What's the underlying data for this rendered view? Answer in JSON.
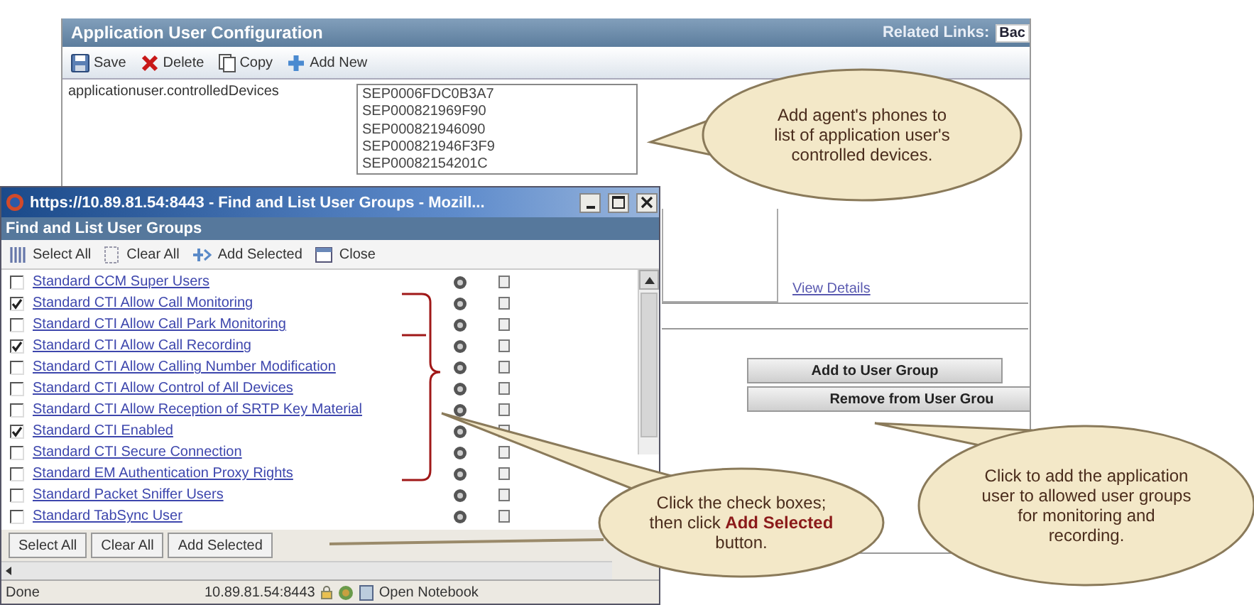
{
  "app_config": {
    "title": "Application User Configuration",
    "related_links": {
      "label": "Related Links:",
      "value": "Bac"
    },
    "toolbar": [
      {
        "label": "Save"
      },
      {
        "label": "Delete"
      },
      {
        "label": "Copy"
      },
      {
        "label": "Add New"
      }
    ],
    "field": {
      "label": "applicationuser.controlledDevices",
      "devices": [
        "SEP0006FDC0B3A7",
        "SEP000821969F90",
        "SEP000821946090",
        "SEP000821946F3F9",
        "SEP00082154201C"
      ]
    },
    "view_details": "View Details",
    "buttons": [
      "Add to User Group",
      "Remove from User Grou"
    ]
  },
  "popup": {
    "title": "https://10.89.81.54:8443 - Find and List User Groups - Mozill...",
    "heading": "Find and List User Groups",
    "toolbar": [
      {
        "label": "Select All"
      },
      {
        "label": "Clear All"
      },
      {
        "label": "Add Selected"
      },
      {
        "label": "Close"
      }
    ],
    "groups": [
      {
        "name": "Standard CCM Super Users",
        "checked": false
      },
      {
        "name": "Standard CTI Allow Call Monitoring",
        "checked": true
      },
      {
        "name": "Standard CTI Allow Call Park Monitoring",
        "checked": false
      },
      {
        "name": "Standard CTI Allow Call Recording",
        "checked": true
      },
      {
        "name": "Standard CTI Allow Calling Number Modification",
        "checked": false
      },
      {
        "name": "Standard CTI Allow Control of All Devices",
        "checked": false
      },
      {
        "name": "Standard CTI Allow Reception of SRTP Key Material",
        "checked": false
      },
      {
        "name": "Standard CTI Enabled",
        "checked": true
      },
      {
        "name": "Standard CTI Secure Connection",
        "checked": false
      },
      {
        "name": "Standard EM Authentication Proxy Rights",
        "checked": false
      },
      {
        "name": "Standard Packet Sniffer Users",
        "checked": false
      },
      {
        "name": "Standard TabSync User",
        "checked": false
      }
    ],
    "buttons": [
      "Select All",
      "Clear All",
      "Add Selected"
    ],
    "status": {
      "text": "Done",
      "address": "10.89.81.54:8443",
      "notebook": "Open Notebook"
    }
  },
  "callouts": [
    {
      "text": "Add agent's phones to list of application user's controlled devices."
    },
    {
      "text": "Click the check boxes; then click **Add Selected** button."
    },
    {
      "text": "Click to add the application user to allowed user groups for monitoring and recording."
    }
  ]
}
